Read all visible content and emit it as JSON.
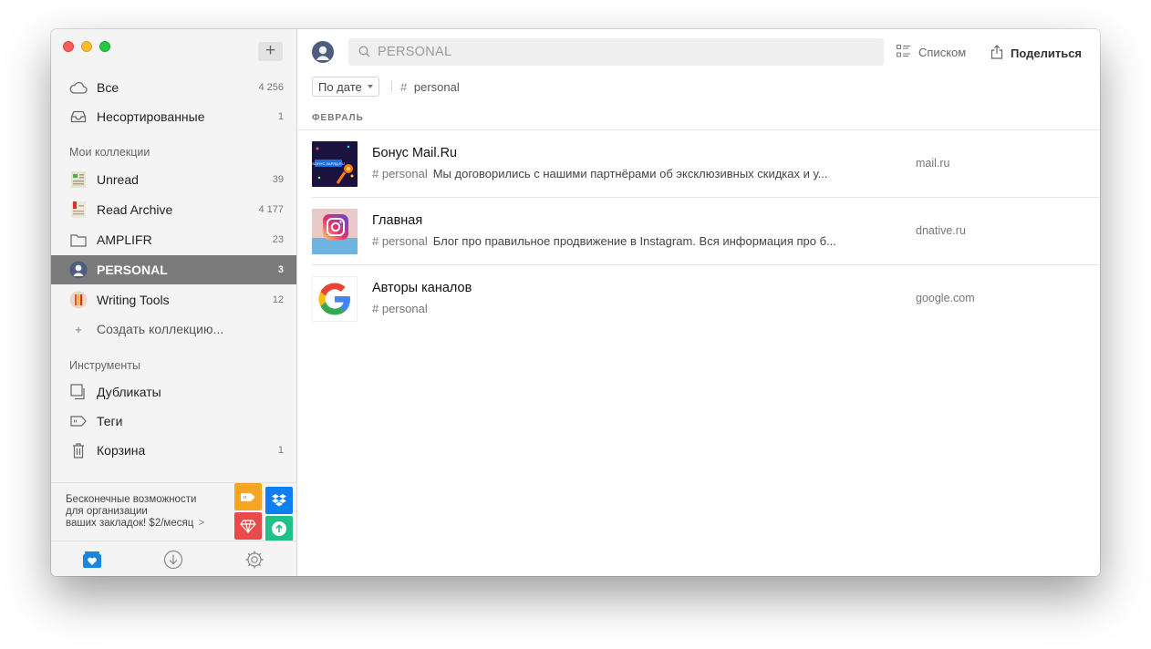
{
  "sidebar": {
    "add_label": "+",
    "all": {
      "label": "Все",
      "count": "4 256"
    },
    "unsorted": {
      "label": "Несортированные",
      "count": "1"
    },
    "collections_heading": "Мои коллекции",
    "collections": [
      {
        "label": "Unread",
        "count": "39"
      },
      {
        "label": "Read Archive",
        "count": "4 177"
      },
      {
        "label": "AMPLIFR",
        "count": "23"
      },
      {
        "label": "PERSONAL",
        "count": "3"
      },
      {
        "label": "Writing Tools",
        "count": "12"
      }
    ],
    "create_icon": "+",
    "create_label": "Создать коллекцию...",
    "tools_heading": "Инструменты",
    "tools": [
      {
        "label": "Дубликаты",
        "count": ""
      },
      {
        "label": "Теги",
        "count": ""
      },
      {
        "label": "Корзина",
        "count": "1"
      }
    ]
  },
  "promo": {
    "line1": "Бесконечные возможности",
    "line2": "для организации",
    "line3": "ваших закладок! $2/месяц",
    "chevron": ">"
  },
  "toolbar": {
    "search_placeholder": "PERSONAL",
    "view_label": "Списком",
    "share_label": "Поделиться"
  },
  "filters": {
    "sort_label": "По дате",
    "tag_hash": "#",
    "tag_label": "personal"
  },
  "list": {
    "month": "ФЕВРАЛЬ",
    "items": [
      {
        "title": "Бонус Mail.Ru",
        "tag": "# personal",
        "excerpt": "Мы договорились с нашими партнёрами об эксклюзивных скидках и у...",
        "domain": "mail.ru"
      },
      {
        "title": "Главная",
        "tag": "# personal",
        "excerpt": "Блог про правильное продвижение в Instagram. Вся информация про б...",
        "domain": "dnative.ru"
      },
      {
        "title": "Авторы каналов",
        "tag": "# personal",
        "excerpt": "",
        "domain": "google.com"
      }
    ]
  },
  "thumb_texts": {
    "mail_banner": "БОНУС.ЗАРЯД.RU"
  },
  "colors": {
    "sidebar_active": "#7b7b7b",
    "promo_orange": "#f5a623",
    "promo_blue": "#0d7ff2",
    "promo_red": "#e94b4b",
    "promo_green": "#21bf8a",
    "bottom_active": "#1a86e0"
  }
}
